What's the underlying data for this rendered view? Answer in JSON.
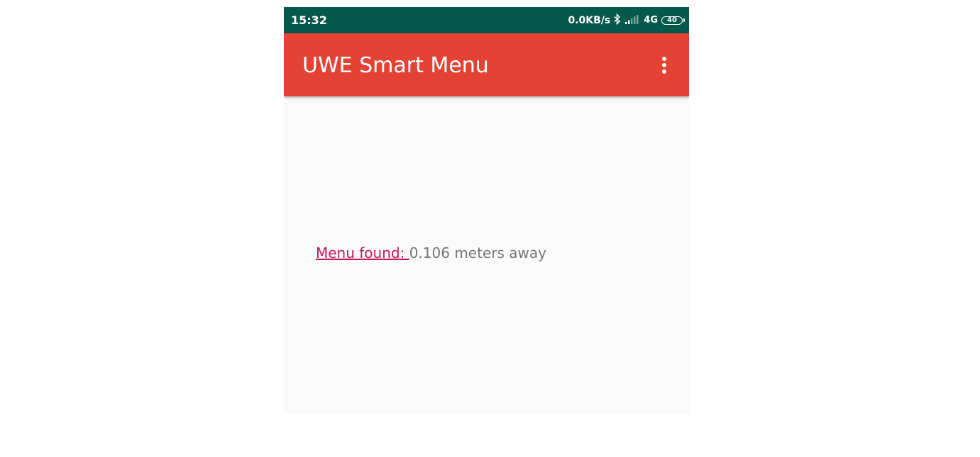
{
  "status_bar": {
    "time": "15:32",
    "speed": "0.0KB/s",
    "network": "4G",
    "battery": "40",
    "icons": [
      "bluetooth-icon",
      "signal-icon"
    ]
  },
  "app_bar": {
    "title": "UWE Smart Menu",
    "overflow_icon": "more-vert-icon"
  },
  "content": {
    "link_label": "Menu found: ",
    "distance_text": "0.106 meters away"
  },
  "colors": {
    "status_bar": "#04594a",
    "app_bar": "#e34235",
    "link": "#c2185b",
    "body_text": "#757575",
    "background": "#fafafa"
  }
}
